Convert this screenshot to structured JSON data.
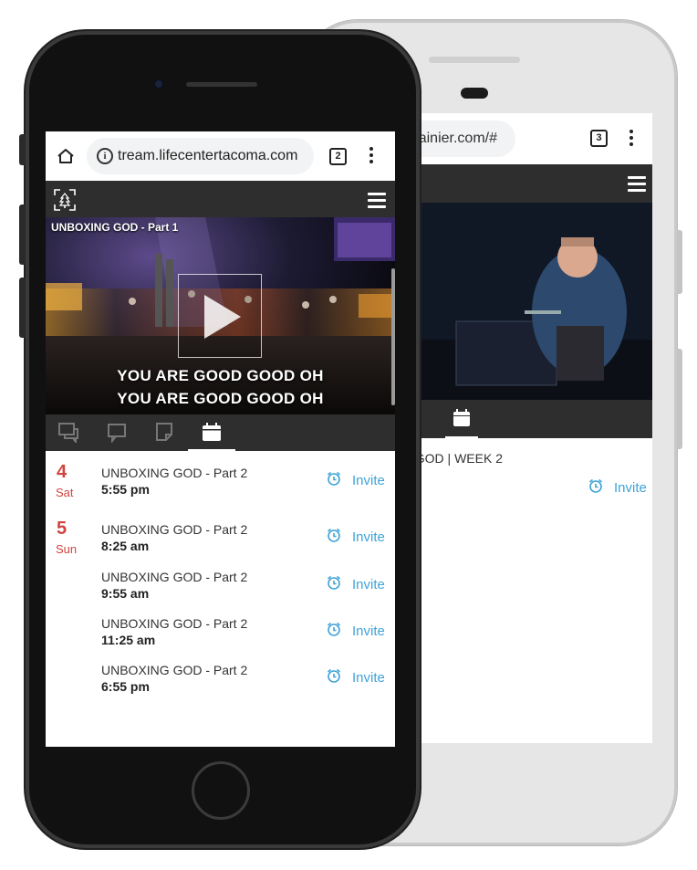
{
  "back_phone": {
    "browser": {
      "url": "ecenterrainier.com/#",
      "tab_count": "3"
    },
    "event": {
      "title": "G GOD | WEEK 2",
      "invite_label": "Invite"
    }
  },
  "front_phone": {
    "browser": {
      "url": "tream.lifecentertacoma.com",
      "tab_count": "2"
    },
    "video": {
      "title": "UNBOXING GOD - Part 1",
      "lyric_line_1": "YOU ARE GOOD GOOD OH",
      "lyric_line_2": "YOU ARE GOOD GOOD OH"
    },
    "tabs": [
      {
        "icon": "chat-bubbles-icon"
      },
      {
        "icon": "comment-icon"
      },
      {
        "icon": "notes-icon"
      },
      {
        "icon": "calendar-icon",
        "active": true
      }
    ],
    "events": [
      {
        "day_num": "4",
        "day_name": "Sat",
        "title": "UNBOXING GOD - Part 2",
        "time": "5:55 pm",
        "invite": "Invite"
      },
      {
        "day_num": "5",
        "day_name": "Sun",
        "title": "UNBOXING GOD - Part 2",
        "time": "8:25 am",
        "invite": "Invite"
      },
      {
        "day_num": "",
        "day_name": "",
        "title": "UNBOXING GOD - Part 2",
        "time": "9:55 am",
        "invite": "Invite"
      },
      {
        "day_num": "",
        "day_name": "",
        "title": "UNBOXING GOD - Part 2",
        "time": "11:25 am",
        "invite": "Invite"
      },
      {
        "day_num": "",
        "day_name": "",
        "title": "UNBOXING GOD - Part 2",
        "time": "6:55 pm",
        "invite": "Invite"
      }
    ]
  },
  "colors": {
    "accent": "#3fa3d6",
    "date": "#d2433e",
    "header": "#2e2e2e"
  }
}
